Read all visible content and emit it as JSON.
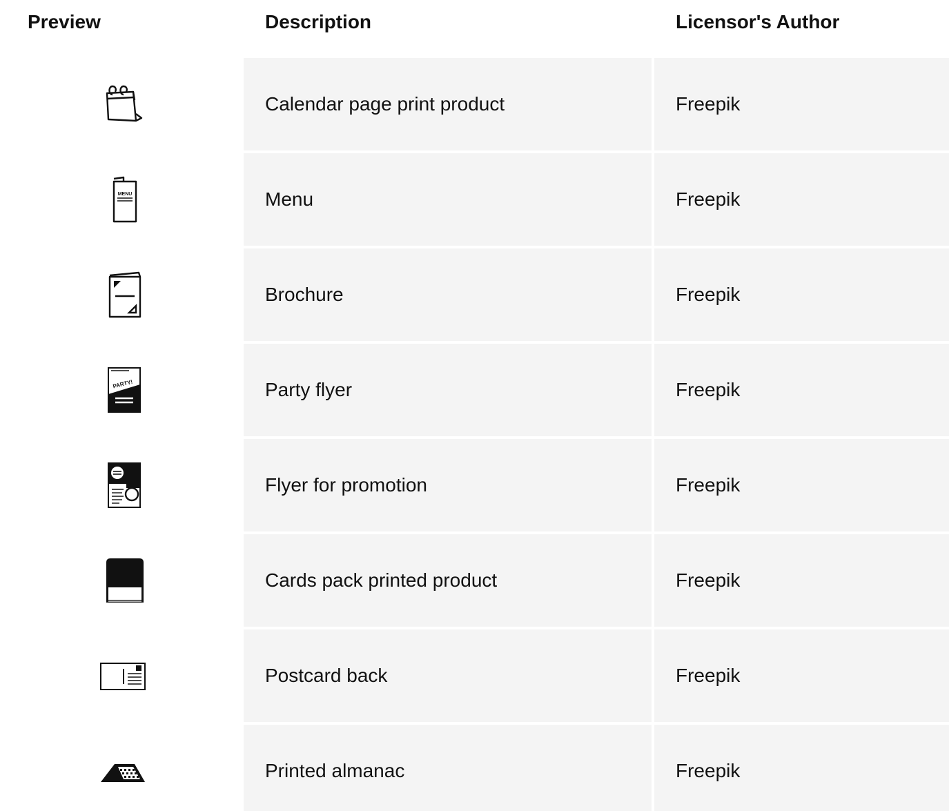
{
  "table": {
    "headers": {
      "preview": "Preview",
      "description": "Description",
      "author": "Licensor's Author"
    },
    "rows": [
      {
        "icon": "calendar-page-icon",
        "description": "Calendar page print product",
        "author": "Freepik"
      },
      {
        "icon": "menu-icon",
        "description": "Menu",
        "author": "Freepik"
      },
      {
        "icon": "brochure-icon",
        "description": "Brochure",
        "author": "Freepik"
      },
      {
        "icon": "party-flyer-icon",
        "description": "Party flyer",
        "author": "Freepik"
      },
      {
        "icon": "promotion-flyer-icon",
        "description": "Flyer for promotion",
        "author": "Freepik"
      },
      {
        "icon": "cards-pack-icon",
        "description": "Cards pack printed product",
        "author": "Freepik"
      },
      {
        "icon": "postcard-back-icon",
        "description": "Postcard back",
        "author": "Freepik"
      },
      {
        "icon": "almanac-icon",
        "description": "Printed almanac",
        "author": "Freepik"
      }
    ]
  }
}
